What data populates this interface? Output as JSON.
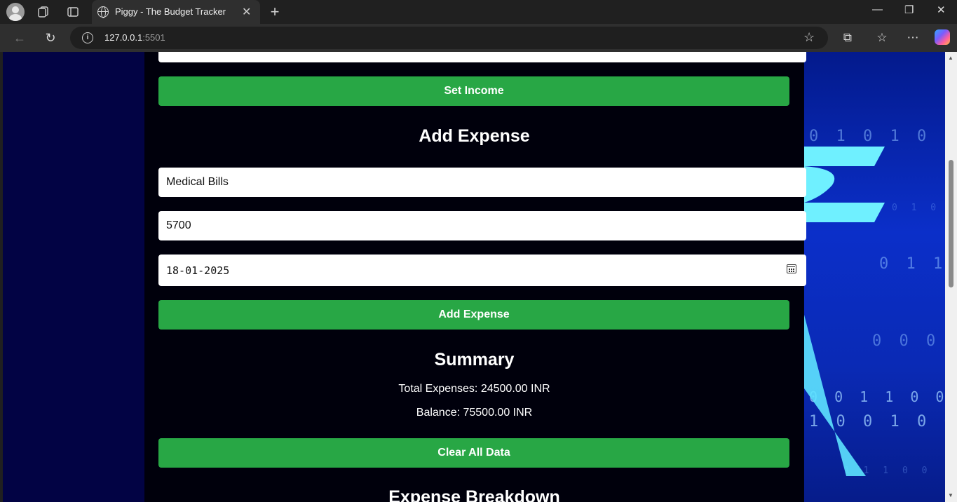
{
  "browser": {
    "tab_title": "Piggy - The Budget Tracker",
    "url_host": "127.0.0.1",
    "url_port": ":5501"
  },
  "page": {
    "set_income_label": "Set Income",
    "add_expense_heading": "Add Expense",
    "expense_name_value": "Medical Bills",
    "expense_amount_value": "5700",
    "expense_date_value": "18-01-2025",
    "add_expense_button": "Add Expense",
    "summary_heading": "Summary",
    "total_expenses": "Total Expenses: 24500.00 INR",
    "balance": "Balance: 75500.00 INR",
    "clear_button": "Clear All Data",
    "breakdown_heading": "Expense Breakdown"
  },
  "theme": {
    "accent_green": "#28a745",
    "page_bg": "#020344"
  },
  "icons": [
    "profile-icon",
    "workspaces-icon",
    "tab-actions-icon",
    "globe-icon",
    "close-icon",
    "new-tab-icon",
    "back-icon",
    "reload-icon",
    "info-icon",
    "favorite-star-icon",
    "extensions-icon",
    "favorites-icon",
    "more-icon",
    "copilot-icon",
    "calendar-icon",
    "rupee-icon"
  ]
}
